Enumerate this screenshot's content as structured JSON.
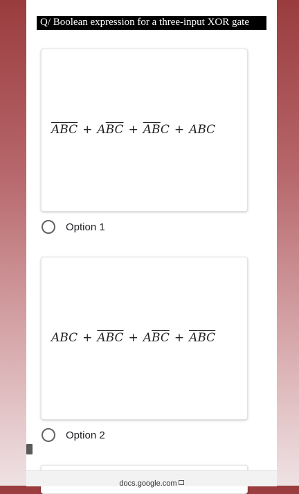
{
  "question": {
    "text": "Q/ Boolean expression for a three-input XOR gate"
  },
  "options": [
    {
      "label": "Option 1",
      "selected": false,
      "expression_text": "A̅B̅C̅ + AB̅C̅ + A̅B̅C + ABC",
      "terms": [
        [
          {
            "v": "A",
            "bar": true
          },
          {
            "v": "B",
            "bar": true
          },
          {
            "v": "C",
            "bar": true
          }
        ],
        [
          {
            "v": "A",
            "bar": false
          },
          {
            "v": "B",
            "bar": true
          },
          {
            "v": "C",
            "bar": true
          }
        ],
        [
          {
            "v": "A",
            "bar": true
          },
          {
            "v": "B",
            "bar": true
          },
          {
            "v": "C",
            "bar": false
          }
        ],
        [
          {
            "v": "A",
            "bar": false
          },
          {
            "v": "B",
            "bar": false
          },
          {
            "v": "C",
            "bar": false
          }
        ]
      ]
    },
    {
      "label": "Option 2",
      "selected": false,
      "expression_text": "ABC + A̅B̅C̅ + AB̅C̅ + A̅B̅C̅",
      "terms": [
        [
          {
            "v": "A",
            "bar": false
          },
          {
            "v": "B",
            "bar": false
          },
          {
            "v": "C",
            "bar": false
          }
        ],
        [
          {
            "v": "A",
            "bar": true
          },
          {
            "v": "B",
            "bar": true
          },
          {
            "v": "C",
            "bar": true
          }
        ],
        [
          {
            "v": "A",
            "bar": false
          },
          {
            "v": "B",
            "bar": true
          },
          {
            "v": "C",
            "bar": true
          }
        ],
        [
          {
            "v": "A",
            "bar": true
          },
          {
            "v": "B",
            "bar": true
          },
          {
            "v": "C",
            "bar": true
          }
        ]
      ]
    }
  ],
  "footer": {
    "url": "docs.google.com"
  }
}
